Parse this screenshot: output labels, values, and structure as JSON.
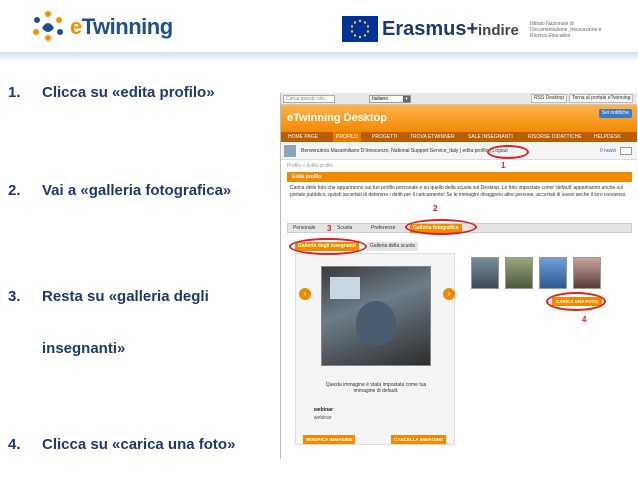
{
  "header": {
    "etwinning_logo_prefix": "e",
    "etwinning_logo_rest": "Twinning",
    "erasmus_logo": "Erasmus+",
    "indire_logo": "indire",
    "indire_tagline": "Istituto Nazionale di Documentazione, Innovazione e Ricerca Educativa"
  },
  "steps": [
    {
      "num": "1.",
      "text": "Clicca su «edita profilo»"
    },
    {
      "num": "2.",
      "text": "Vai a «galleria fotografica»"
    },
    {
      "num": "3.",
      "text": "Resta su «galleria degli"
    },
    {
      "num": "",
      "text": "insegnanti»"
    },
    {
      "num": "4.",
      "text": "Clicca su «carica una foto»"
    }
  ],
  "screenshot": {
    "search_placeholder": "Cerca questo sito",
    "language": "Italiano",
    "rss_button": "RSS Desktop",
    "portal_button": "Torna al portale eTwinning",
    "brand_e": "e",
    "brand_rest": "Twinning Desktop",
    "notify": "Sei notifiche",
    "nav": [
      "HOME PAGE",
      "PROFILO",
      "PROGETTI",
      "TROVA ETWINNER",
      "SALE INSEGNANTI",
      "RISORSE DIDATTICHE",
      "HELPDESK"
    ],
    "welcome_text": "Benvenuto/a Massimiliano D'Innocenzo, National Support Service_Italy | edita profilo | Logout",
    "messages": "0 nuovi",
    "breadcrumb": "Profilo » Edita profilo",
    "section_title": "Edita profilo",
    "description": "Carica delle foto che appariranno sul tuo profilo personale e su quello della scuola sul Desktop. Le foto impostate come 'default' appariranno anche sul portale pubblico, quindi accertati di detenere i diritti per il caricamento! Se le immagini ritraggono altre persone, accertati di avere anche il loro consenso.",
    "tabs_primary": [
      "Personale",
      "Scuola",
      "Preferenze",
      "Galleria fotografica"
    ],
    "tabs_secondary": [
      "Galleria degli insegnanti",
      "Galleria della scuola"
    ],
    "photo_caption": "Questa immagine è stata impostata come tua immagine di default.",
    "field_label": "webinar",
    "field_value": "webinar",
    "edit_button": "MODIFICA IMMAGINE",
    "delete_button": "CANCELLA IMMAGINE",
    "upload_button": "CARICA UNA FOTO",
    "arrow_left": "‹",
    "arrow_right": "›",
    "annotations": [
      "1",
      "2",
      "3",
      "4"
    ]
  },
  "colors": {
    "accent": "#f28a00",
    "heading_text": "#1d3a6e",
    "annotation": "#e02020"
  }
}
